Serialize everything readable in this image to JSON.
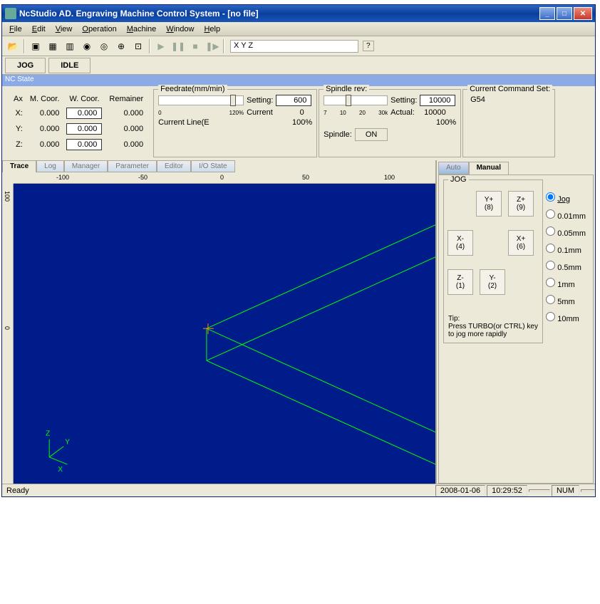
{
  "window": {
    "title": "NcStudio AD. Engraving Machine Control System  - [no file]"
  },
  "menu": {
    "file": "File",
    "edit": "Edit",
    "view": "View",
    "operation": "Operation",
    "machine": "Machine",
    "window": "Window",
    "help": "Help"
  },
  "toolbar": {
    "xyz": "X       Y       Z"
  },
  "status_buttons": {
    "jog": "JOG",
    "idle": "IDLE"
  },
  "ncstate": "NC State",
  "coords": {
    "ax": "Ax",
    "mcoor": "M. Coor.",
    "wcoor": "W. Coor.",
    "remainer": "Remainer",
    "x": "X:",
    "y": "Y:",
    "z": "Z:",
    "xm": "0.000",
    "xw": "0.000",
    "xr": "0.000",
    "ym": "0.000",
    "yw": "0.000",
    "yr": "0.000",
    "zm": "0.000",
    "zw": "0.000",
    "zr": "0.000"
  },
  "feedrate": {
    "legend": "Feedrate(mm/min)",
    "setting_label": "Setting:",
    "setting": "600",
    "t0": "0",
    "t120": "120%",
    "current_label": "Current",
    "current": "0",
    "line_label": "Current Line(E",
    "pct": "100%"
  },
  "spindle": {
    "legend": "Spindle rev:",
    "setting_label": "Setting:",
    "setting": "10000",
    "t7": "7",
    "t10": "10",
    "t20": "20",
    "t30k": "30k",
    "actual_label": "Actual:",
    "actual": "10000",
    "pct": "100%",
    "spindle_label": "Spindle:",
    "on": "ON"
  },
  "cmdset": {
    "legend": "Current Command Set:",
    "value": "G54"
  },
  "left_tabs": {
    "trace": "Trace",
    "log": "Log",
    "manager": "Manager",
    "parameter": "Parameter",
    "editor": "Editor",
    "io": "I/O State"
  },
  "ruler_h": {
    "m100": "-100",
    "m50": "-50",
    "z": "0",
    "p50": "50",
    "p100": "100"
  },
  "ruler_v": {
    "p100": "100",
    "z": "0"
  },
  "right_tabs": {
    "auto": "Auto",
    "manual": "Manual"
  },
  "jog": {
    "legend": "JOG",
    "yplus": "Y+",
    "yplus_k": "(8)",
    "zplus": "Z+",
    "zplus_k": "(9)",
    "xminus": "X-",
    "xminus_k": "(4)",
    "xplus": "X+",
    "xplus_k": "(6)",
    "zminus": "Z-",
    "zminus_k": "(1)",
    "yminus": "Y-",
    "yminus_k": "(2)",
    "tip_label": "Tip:",
    "tip": "Press TURBO(or CTRL) key to jog more rapidly"
  },
  "radios": {
    "jog": "Jog",
    "r001": "0.01mm",
    "r005": "0.05mm",
    "r01": "0.1mm",
    "r05": "0.5mm",
    "r1": "1mm",
    "r5": "5mm",
    "r10": "10mm"
  },
  "statusbar": {
    "ready": "Ready",
    "date": "2008-01-06",
    "time": "10:29:52",
    "num": "NUM"
  },
  "axis_ind": {
    "z": "Z",
    "y": "Y",
    "x": "X"
  }
}
